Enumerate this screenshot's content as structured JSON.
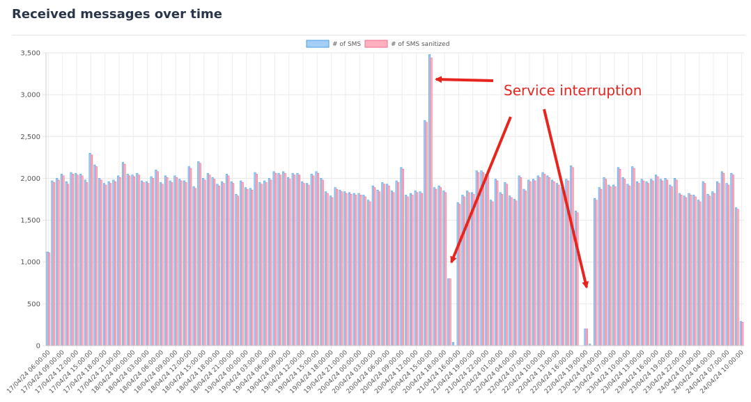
{
  "page": {
    "title": "Received messages over time"
  },
  "chart_data": {
    "type": "bar",
    "title": "",
    "xlabel": "",
    "ylabel": "",
    "ylim": [
      0,
      3500
    ],
    "yticks": [
      0,
      500,
      1000,
      1500,
      2000,
      2500,
      3000,
      3500
    ],
    "grid": true,
    "legend_position": "top-center",
    "colors": {
      "sms": {
        "fill": "#a4cef5",
        "stroke": "#4a9de0"
      },
      "sanitized": {
        "fill": "#ffb1c0",
        "stroke": "#f06a88"
      }
    },
    "x_labels": [
      "17/04/24 06:00:00",
      "17/04/24 09:00:00",
      "17/04/24 12:00:00",
      "17/04/24 15:00:00",
      "17/04/24 18:00:00",
      "17/04/24 21:00:00",
      "18/04/24 00:00:00",
      "18/04/24 03:00:00",
      "18/04/24 06:00:00",
      "18/04/24 09:00:00",
      "18/04/24 12:00:00",
      "18/04/24 15:00:00",
      "18/04/24 18:00:00",
      "18/04/24 21:00:00",
      "19/04/24 00:00:00",
      "19/04/24 03:00:00",
      "19/04/24 06:00:00",
      "19/04/24 09:00:00",
      "19/04/24 12:00:00",
      "19/04/24 15:00:00",
      "19/04/24 18:00:00",
      "19/04/24 21:00:00",
      "20/04/24 00:00:00",
      "20/04/24 03:00:00",
      "20/04/24 06:00:00",
      "20/04/24 09:00:00",
      "20/04/24 12:00:00",
      "20/04/24 15:00:00",
      "20/04/24 18:00:00",
      "21/04/24 16:00:00",
      "21/04/24 19:00:00",
      "21/04/24 22:00:00",
      "22/04/24 01:00:00",
      "22/04/24 04:00:00",
      "22/04/24 07:00:00",
      "22/04/24 10:00:00",
      "22/04/24 13:00:00",
      "22/04/24 16:00:00",
      "22/04/24 19:00:00",
      "23/04/24 04:00:00",
      "23/04/24 07:00:00",
      "23/04/24 10:00:00",
      "23/04/24 13:00:00",
      "23/04/24 16:00:00",
      "23/04/24 19:00:00",
      "23/04/24 22:00:00",
      "24/04/24 01:00:00",
      "24/04/24 04:00:00",
      "24/04/24 07:00:00",
      "24/04/24 10:00:00"
    ],
    "series": [
      {
        "name": "# of SMS",
        "values": [
          1120,
          1970,
          2000,
          2050,
          1960,
          2070,
          2060,
          2050,
          1980,
          2300,
          2160,
          2000,
          1940,
          1960,
          1980,
          2030,
          2190,
          2050,
          2040,
          2060,
          1970,
          1960,
          2020,
          2100,
          1950,
          2030,
          1970,
          2030,
          1990,
          1970,
          2140,
          1900,
          2200,
          2000,
          2060,
          2010,
          1930,
          1960,
          2050,
          1960,
          1810,
          1970,
          1890,
          1880,
          2070,
          1950,
          1970,
          2000,
          2080,
          2060,
          2080,
          2010,
          2060,
          2060,
          1960,
          1940,
          2050,
          2080,
          2000,
          1840,
          1790,
          1890,
          1860,
          1840,
          1830,
          1820,
          1820,
          1800,
          1740,
          1910,
          1860,
          1950,
          1930,
          1850,
          1970,
          2130,
          1800,
          1820,
          1850,
          1840,
          2690,
          3480,
          1890,
          1910,
          1850,
          800,
          40,
          1710,
          1800,
          1850,
          1830,
          2090,
          2090,
          2050,
          1740,
          1990,
          1830,
          1950,
          1790,
          1750,
          2030,
          1870,
          1980,
          1990,
          2030,
          2070,
          2030,
          1980,
          1940,
          1890,
          1990,
          2150,
          1610,
          0,
          200,
          20,
          1760,
          1890,
          2010,
          1920,
          1920,
          2130,
          2010,
          1930,
          2140,
          1960,
          1990,
          1960,
          1990,
          2040,
          1990,
          2000,
          1920,
          2000,
          1820,
          1790,
          1820,
          1800,
          1740,
          1960,
          1810,
          1840,
          1960,
          2080,
          1940,
          2060,
          1650,
          290
        ]
      },
      {
        "name": "# of SMS sanitized",
        "values": [
          1110,
          1950,
          1980,
          2030,
          1930,
          2050,
          2040,
          2030,
          1950,
          2280,
          2140,
          1980,
          1920,
          1940,
          1960,
          2010,
          2170,
          2030,
          2020,
          2040,
          1950,
          1940,
          2000,
          2080,
          1930,
          2010,
          1950,
          2010,
          1970,
          1950,
          2120,
          1880,
          2180,
          1980,
          2040,
          1990,
          1910,
          1940,
          2030,
          1940,
          1790,
          1950,
          1870,
          1860,
          2050,
          1930,
          1950,
          1980,
          2060,
          2040,
          2060,
          1990,
          2040,
          2040,
          1940,
          1920,
          2030,
          2060,
          1980,
          1820,
          1770,
          1870,
          1840,
          1820,
          1810,
          1800,
          1800,
          1780,
          1720,
          1890,
          1840,
          1930,
          1910,
          1830,
          1950,
          2110,
          1780,
          1800,
          1830,
          1820,
          2670,
          3440,
          1870,
          1890,
          1830,
          800,
          0,
          1690,
          1780,
          1830,
          1810,
          2070,
          2070,
          2030,
          1720,
          1970,
          1810,
          1930,
          1770,
          1730,
          2010,
          1850,
          1960,
          1970,
          2010,
          2050,
          2010,
          1960,
          1920,
          1870,
          1970,
          2130,
          1590,
          0,
          200,
          0,
          1740,
          1870,
          1990,
          1900,
          1900,
          2110,
          1990,
          1910,
          2120,
          1940,
          1970,
          1940,
          1970,
          2020,
          1970,
          1980,
          1900,
          1980,
          1800,
          1770,
          1800,
          1780,
          1720,
          1940,
          1790,
          1820,
          1940,
          2060,
          1920,
          2040,
          1630,
          280
        ]
      }
    ],
    "annotations": [
      {
        "text": "Service interruption"
      }
    ]
  }
}
